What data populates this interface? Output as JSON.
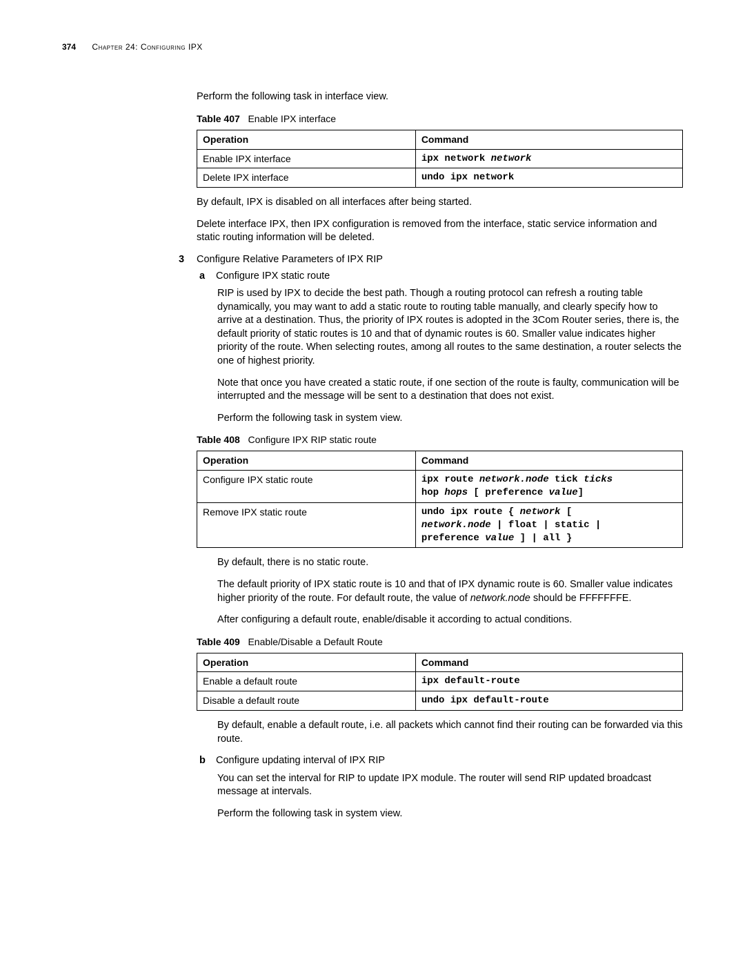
{
  "header": {
    "page_number": "374",
    "chapter": "Chapter 24: Configuring IPX"
  },
  "p_intro1": "Perform the following task in interface view.",
  "table407": {
    "caption_label": "Table 407",
    "caption_text": "Enable IPX interface",
    "col_op": "Operation",
    "col_cmd": "Command",
    "r1_op": "Enable IPX interface",
    "r1_cmd_a": "ipx network ",
    "r1_cmd_b": "network",
    "r2_op": "Delete IPX interface",
    "r2_cmd": "undo ipx network"
  },
  "p_after407a": "By default, IPX is disabled on all interfaces after being started.",
  "p_after407b": "Delete interface IPX, then IPX configuration is removed from the interface, static service information and static routing information will be deleted.",
  "item3": {
    "marker": "3",
    "text": "Configure Relative Parameters of IPX RIP"
  },
  "item3a": {
    "marker": "a",
    "text": "Configure IPX static route"
  },
  "p_rip1": "RIP is used by IPX to decide the best path. Though a routing protocol can refresh a routing table dynamically, you may want to add a static route to routing table manually, and clearly specify how to arrive at a destination. Thus, the priority of IPX routes is adopted in the 3Com Router series, there is, the default priority of static routes is 10 and that of dynamic routes is 60. Smaller value indicates higher priority of the route. When selecting routes, among all routes to the same destination, a router selects the one of highest priority.",
  "p_rip2": "Note that once you have created a static route, if one section of the route is faulty, communication will be interrupted and the message will be sent to a destination that does not exist.",
  "p_rip3": "Perform the following task in system view.",
  "table408": {
    "caption_label": "Table 408",
    "caption_text": "Configure IPX RIP static route",
    "col_op": "Operation",
    "col_cmd": "Command",
    "r1_op": "Configure IPX static route",
    "r1_cmd_l1a": "ipx route ",
    "r1_cmd_l1b": "network.node",
    "r1_cmd_l1c": " tick ",
    "r1_cmd_l1d": "ticks",
    "r1_cmd_l2a": "hop ",
    "r1_cmd_l2b": "hops",
    "r1_cmd_l2c": " [ preference ",
    "r1_cmd_l2d": "value",
    "r1_cmd_l2e": "]",
    "r2_op": "Remove IPX static route",
    "r2_cmd_l1a": "undo ipx route { ",
    "r2_cmd_l1b": "network",
    "r2_cmd_l1c": " [",
    "r2_cmd_l2a": "network.node",
    "r2_cmd_l2b": " | float | static |",
    "r2_cmd_l3a": "preference ",
    "r2_cmd_l3b": "value",
    "r2_cmd_l3c": " ] | all }"
  },
  "p_after408a": "By default, there is no static route.",
  "p_after408b_1": "The default priority of IPX static route is 10 and that of IPX dynamic route is 60. Smaller value indicates higher priority of the route. For default route, the value of ",
  "p_after408b_2": "network.node",
  "p_after408b_3": " should be FFFFFFFE.",
  "p_after408c": "After configuring a default route, enable/disable it according to actual conditions.",
  "table409": {
    "caption_label": "Table 409",
    "caption_text": "Enable/Disable a Default Route",
    "col_op": "Operation",
    "col_cmd": "Command",
    "r1_op": "Enable a default route",
    "r1_cmd": "ipx default-route",
    "r2_op": "Disable a default route",
    "r2_cmd": "undo ipx default-route"
  },
  "p_after409": "By default, enable a default route, i.e. all packets which cannot find their routing can be forwarded via this route.",
  "item3b": {
    "marker": "b",
    "text": "Configure updating interval of IPX RIP"
  },
  "p_bend1": "You can set the interval for RIP to update IPX module. The router will send RIP updated broadcast message at intervals.",
  "p_bend2": "Perform the following task in system view."
}
